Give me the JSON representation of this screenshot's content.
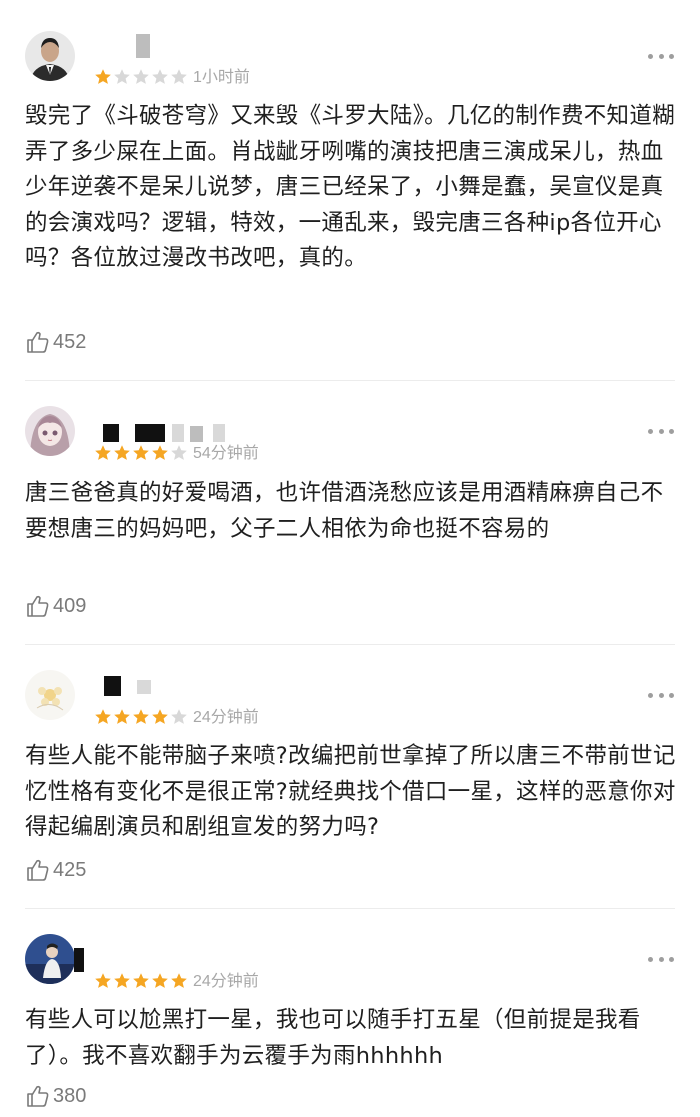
{
  "colors": {
    "star_filled": "#f5a623",
    "star_empty": "#d8d8d8",
    "text": "#1f1f1f",
    "meta": "#a8a8a8",
    "divider": "#ececec"
  },
  "comments": [
    {
      "rating": 1,
      "max_rating": 5,
      "time": "1小时前",
      "text": "毁完了《斗破苍穹》又来毁《斗罗大陆》。几亿的制作费不知道糊弄了多少屎在上面。肖战龇牙咧嘴的演技把唐三演成呆儿，热血少年逆袭不是呆儿说梦，唐三已经呆了，小舞是蠢，吴宣仪是真的会演戏吗？逻辑，特效，一通乱来，毁完唐三各种ip各位开心吗？各位放过漫改书改吧，真的。",
      "likes": "452",
      "avatar_icon": "man-in-suit-avatar"
    },
    {
      "rating": 4,
      "max_rating": 5,
      "time": "54分钟前",
      "text": "唐三爸爸真的好爱喝酒，也许借酒浇愁应该是用酒精麻痹自己不要想唐三的妈妈吧，父子二人相依为命也挺不容易的",
      "likes": "409",
      "avatar_icon": "anime-girl-avatar"
    },
    {
      "rating": 4,
      "max_rating": 5,
      "time": "24分钟前",
      "text": "有些人能不能带脑子来喷?改编把前世拿掉了所以唐三不带前世记忆性格有变化不是很正常?就经典找个借口一星，这样的恶意你对得起编剧演员和剧组宣发的努力吗?",
      "likes": "425",
      "avatar_icon": "flower-avatar"
    },
    {
      "rating": 5,
      "max_rating": 5,
      "time": "24分钟前",
      "text": "有些人可以尬黑打一星，我也可以随手打五星（但前提是我看了）。我不喜欢翻手为云覆手为雨hhhhhh",
      "likes": "380",
      "avatar_icon": "performer-avatar"
    }
  ]
}
